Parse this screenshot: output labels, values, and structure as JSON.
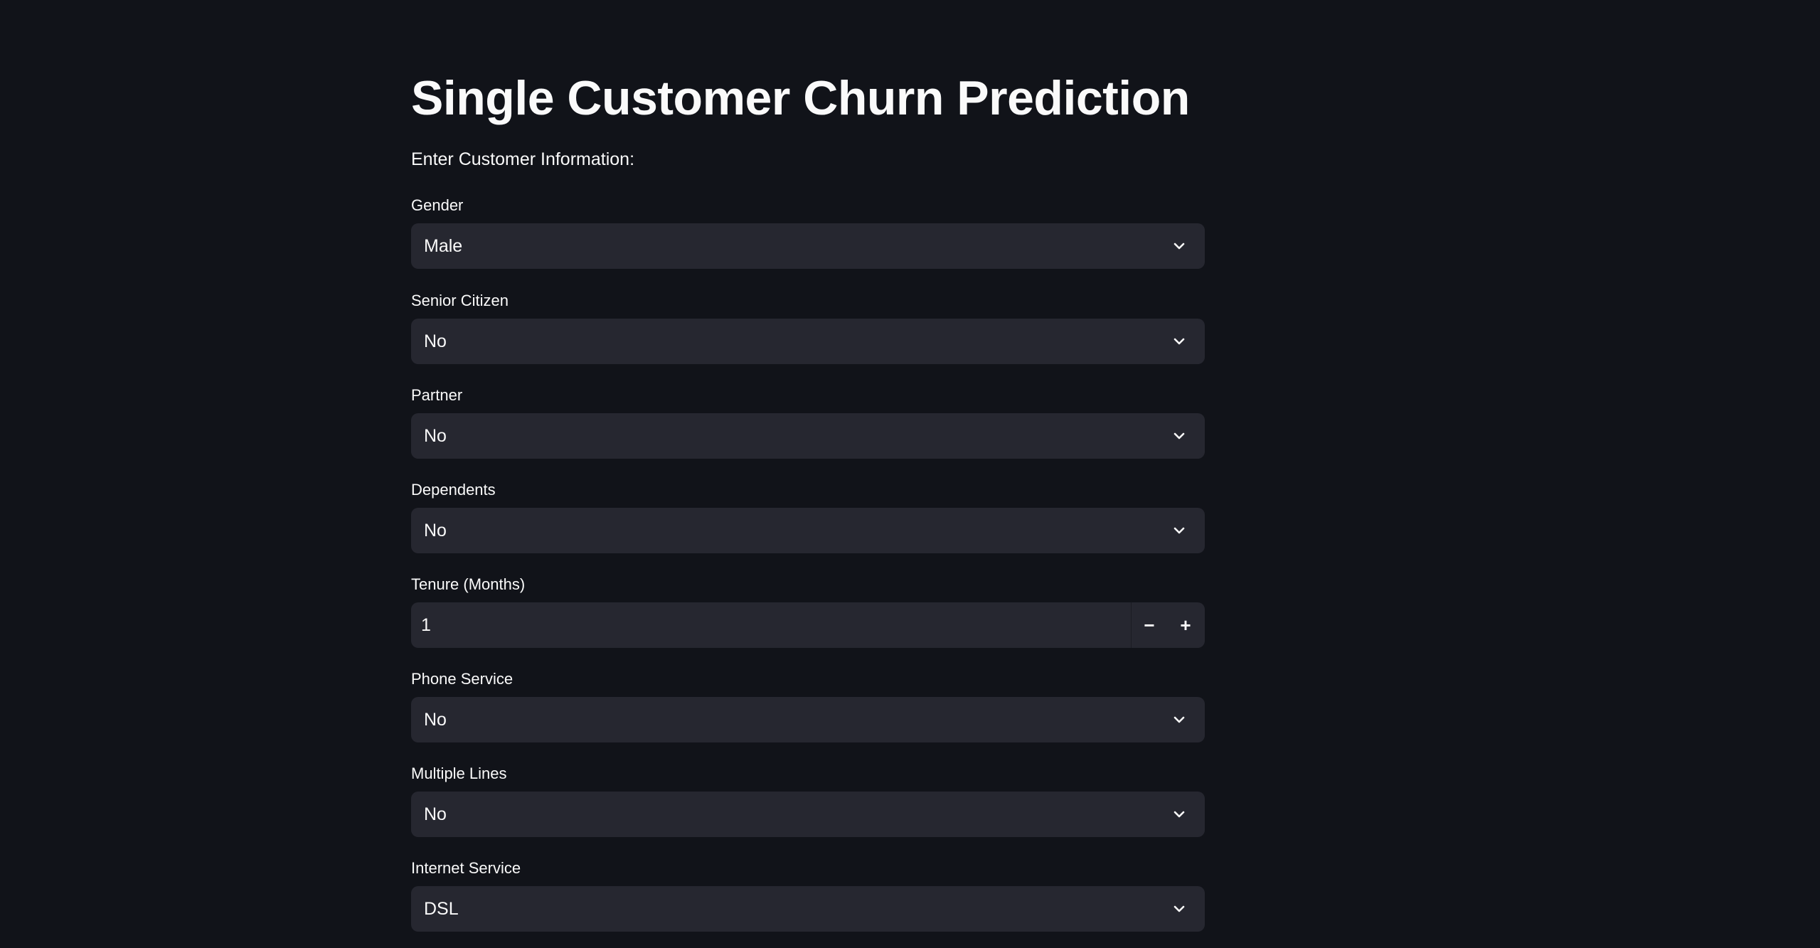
{
  "page": {
    "title": "Single Customer Churn Prediction",
    "subheading": "Enter Customer Information:"
  },
  "fields": {
    "gender": {
      "label": "Gender",
      "value": "Male"
    },
    "senior_citizen": {
      "label": "Senior Citizen",
      "value": "No"
    },
    "partner": {
      "label": "Partner",
      "value": "No"
    },
    "dependents": {
      "label": "Dependents",
      "value": "No"
    },
    "tenure": {
      "label": "Tenure (Months)",
      "value": "1",
      "minus": "−",
      "plus": "+"
    },
    "phone_service": {
      "label": "Phone Service",
      "value": "No"
    },
    "multiple_lines": {
      "label": "Multiple Lines",
      "value": "No"
    },
    "internet_service": {
      "label": "Internet Service",
      "value": "DSL"
    }
  },
  "icons": {
    "dropdown": "chevron-down-icon"
  },
  "colors": {
    "background": "#111319",
    "input_background": "#262730",
    "text": "#fafafa"
  }
}
